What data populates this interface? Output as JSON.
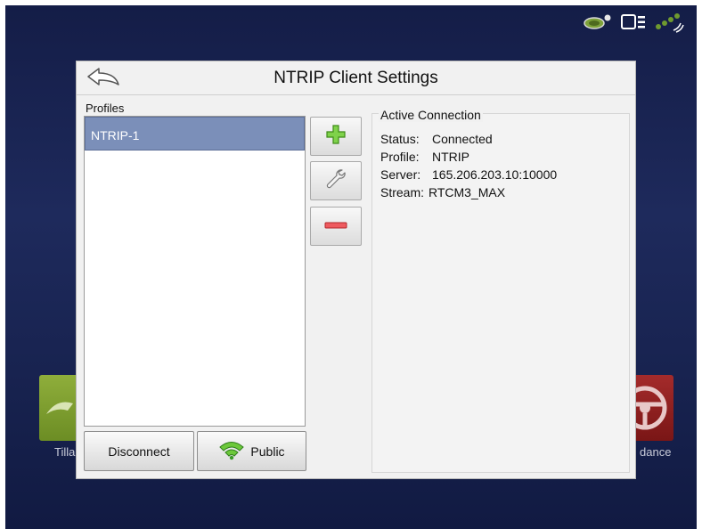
{
  "status_bar": {
    "icons": [
      "gps-receiver-icon",
      "display-module-icon",
      "satellite-signal-icon"
    ]
  },
  "background": {
    "left_tile_label": "Tilla",
    "right_tile_label": "dance"
  },
  "dialog": {
    "title": "NTRIP Client Settings",
    "profiles_label": "Profiles",
    "profiles": [
      {
        "name": "NTRIP-1",
        "selected": true
      }
    ],
    "buttons": {
      "disconnect": "Disconnect",
      "public": "Public"
    },
    "active_connection": {
      "title": "Active Connection",
      "status_label": "Status:",
      "status_value": "Connected",
      "profile_label": "Profile:",
      "profile_value": "NTRIP",
      "server_label": "Server:",
      "server_value": "165.206.203.10:10000",
      "stream_label": "Stream:",
      "stream_value": "RTCM3_MAX"
    }
  },
  "colors": {
    "selected_row": "#7b8fb9",
    "add_icon": "#4caf1e",
    "remove_icon": "#d9343a",
    "wifi_icon": "#3fae2a"
  }
}
